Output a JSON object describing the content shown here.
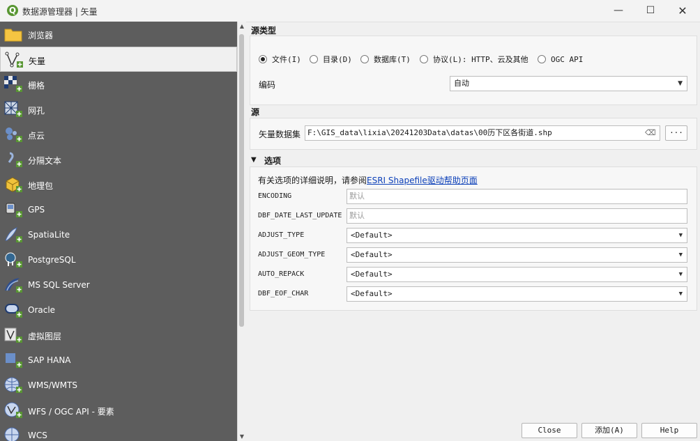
{
  "window": {
    "title": "数据源管理器 | 矢量",
    "app_icon_letter": "Q",
    "minimize": "—",
    "maximize": "☐",
    "close": "✕"
  },
  "sidebar": {
    "items": [
      {
        "label": "浏览器",
        "icon": "folder-icon"
      },
      {
        "label": "矢量",
        "icon": "vector-icon"
      },
      {
        "label": "栅格",
        "icon": "raster-icon"
      },
      {
        "label": "网孔",
        "icon": "mesh-icon"
      },
      {
        "label": "点云",
        "icon": "point-cloud-icon"
      },
      {
        "label": "分隔文本",
        "icon": "delimited-text-icon"
      },
      {
        "label": "地理包",
        "icon": "geopackage-icon"
      },
      {
        "label": "GPS",
        "icon": "gps-icon"
      },
      {
        "label": "SpatiaLite",
        "icon": "spatialite-icon"
      },
      {
        "label": "PostgreSQL",
        "icon": "postgresql-icon"
      },
      {
        "label": "MS SQL Server",
        "icon": "mssql-icon"
      },
      {
        "label": "Oracle",
        "icon": "oracle-icon"
      },
      {
        "label": "虚拟图层",
        "icon": "virtual-layer-icon"
      },
      {
        "label": "SAP HANA",
        "icon": "sap-hana-icon"
      },
      {
        "label": "WMS/WMTS",
        "icon": "wms-icon"
      },
      {
        "label": "WFS / OGC API - 要素",
        "icon": "wfs-icon"
      },
      {
        "label": "WCS",
        "icon": "wcs-icon"
      }
    ],
    "active_index": 1
  },
  "source_type": {
    "title": "源类型",
    "options": [
      {
        "label": "文件(I)",
        "checked": true
      },
      {
        "label": "目录(D)",
        "checked": false
      },
      {
        "label": "数据库(T)",
        "checked": false
      },
      {
        "label": "协议(L): HTTP、云及其他",
        "checked": false
      },
      {
        "label": "OGC API",
        "checked": false
      }
    ],
    "encoding_label": "编码",
    "encoding_value": "自动"
  },
  "source": {
    "title": "源",
    "dataset_label": "矢量数据集",
    "dataset_value": "F:\\GIS_data\\lixia\\20241203Data\\datas\\00历下区各街道.shp",
    "clear_icon": "⌫",
    "browse_label": "···"
  },
  "options": {
    "title": "选项",
    "collapse_icon": "▼",
    "help_prefix": "有关选项的详细说明，请参阅",
    "help_link": "ESRI Shapefile驱动帮助页面",
    "rows": [
      {
        "label": "ENCODING",
        "kind": "text",
        "placeholder": "默认"
      },
      {
        "label": "DBF_DATE_LAST_UPDATE",
        "kind": "text",
        "placeholder": "默认"
      },
      {
        "label": "ADJUST_TYPE",
        "kind": "combo",
        "value": "<Default>"
      },
      {
        "label": "ADJUST_GEOM_TYPE",
        "kind": "combo",
        "value": "<Default>"
      },
      {
        "label": "AUTO_REPACK",
        "kind": "combo",
        "value": "<Default>"
      },
      {
        "label": "DBF_EOF_CHAR",
        "kind": "combo",
        "value": "<Default>"
      }
    ]
  },
  "footer": {
    "close": "Close",
    "add": "添加(A)",
    "help": "Help"
  },
  "colors": {
    "sidebar_bg": "#5d5d5d",
    "qgis_green": "#589632",
    "link": "#0b3fb8"
  }
}
